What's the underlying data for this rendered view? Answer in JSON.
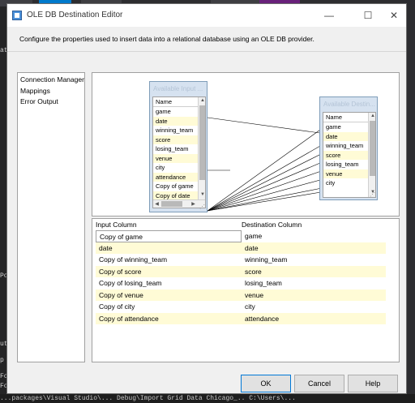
{
  "background": {
    "bottom_text": "...packages\\Visual Studio\\... Debug\\Import Grid Data Chicago_.. C:\\Users\\...",
    "left_snippets": [
      "ata",
      "Po",
      "ut",
      "p",
      "Fo",
      "Fo"
    ]
  },
  "dialog": {
    "title": "OLE DB Destination Editor",
    "minimize": "—",
    "maximize": "☐",
    "close": "✕",
    "description": "Configure the properties used to insert data into a relational database using an OLE DB provider."
  },
  "nav": {
    "items": [
      "Connection Manager",
      "Mappings",
      "Error Output"
    ]
  },
  "input_table": {
    "header": "Available Input ...",
    "rows": [
      "Name",
      "game",
      "date",
      "winning_team",
      "score",
      "losing_team",
      "venue",
      "city",
      "attendance",
      "Copy of game",
      "Copy of date"
    ]
  },
  "dest_table": {
    "header": "Available Destin...",
    "rows": [
      "Name",
      "game",
      "date",
      "winning_team",
      "score",
      "losing_team",
      "venue",
      "city"
    ]
  },
  "mapping_grid": {
    "col1": "Input Column",
    "col2": "Destination Column",
    "rows": [
      {
        "input": "Copy of game",
        "dest": "game"
      },
      {
        "input": "date",
        "dest": "date"
      },
      {
        "input": "Copy of winning_team",
        "dest": "winning_team"
      },
      {
        "input": "Copy of score",
        "dest": "score"
      },
      {
        "input": "Copy of losing_team",
        "dest": "losing_team"
      },
      {
        "input": "Copy of venue",
        "dest": "venue"
      },
      {
        "input": "Copy of city",
        "dest": "city"
      },
      {
        "input": "Copy of attendance",
        "dest": "attendance"
      }
    ]
  },
  "buttons": {
    "ok": "OK",
    "cancel": "Cancel",
    "help": "Help"
  },
  "colors": {
    "accent": "#0078d7",
    "highlight_row": "#fffbd6"
  }
}
